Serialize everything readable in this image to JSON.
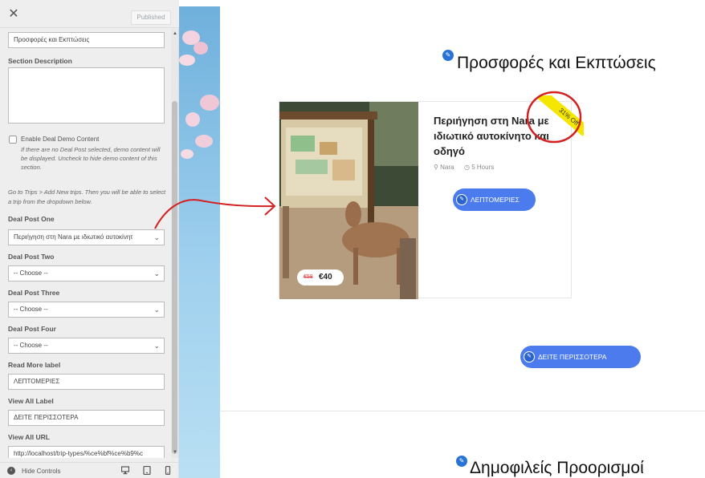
{
  "panel": {
    "published_label": "Published",
    "section_title_value": "Προσφορές και Εκπτώσεις",
    "section_description_label": "Section Description",
    "enable_demo_label": "Enable Deal Demo Content",
    "enable_demo_desc": "If there are no Deal Post selected, demo content will be displayed. Uncheck to hide demo content of this section.",
    "trips_hint": "Go to Trips > Add New trips. Then you will be able to select a trip from the dropdown below.",
    "deal_post_one_label": "Deal Post One",
    "deal_post_one_value": "Περιήγηση στη Nara με ιδιωτικό αυτοκίνητ",
    "deal_post_two_label": "Deal Post Two",
    "deal_post_two_value": "-- Choose --",
    "deal_post_three_label": "Deal Post Three",
    "deal_post_three_value": "-- Choose --",
    "deal_post_four_label": "Deal Post Four",
    "deal_post_four_value": "-- Choose --",
    "read_more_label": "Read More label",
    "read_more_value": "ΛΕΠΤΟΜΕΡΙΕΣ",
    "view_all_label": "View All Label",
    "view_all_value": "ΔΕΙΤΕ ΠΕΡΙΣΣΟΤΕΡΑ",
    "view_all_url_label": "View All URL",
    "view_all_url_value": "http://localhost/trip-types/%ce%bf%ce%b9%c",
    "hide_controls_label": "Hide Controls"
  },
  "preview": {
    "section_title": "Προσφορές και Εκπτώσεις",
    "trip_title": "Περιήγηση στη Nara με ιδιωτικό αυτοκίνητο και οδηγό",
    "location": "Nara",
    "duration": "5 Hours",
    "discount_badge": "31% Off",
    "read_more_button": "ΛΕΠΤΟΜΕΡΙΕΣ",
    "price_old": "€58",
    "price_new": "€40",
    "view_all_button": "ΔΕΙΤΕ ΠΕΡΙΣΣΟΤΕΡΑ",
    "next_section_title": "Δημοφιλείς Προορισμοί"
  },
  "colors": {
    "accent": "#4b7bec",
    "annotation_red": "#d42020",
    "badge_yellow": "#f5e600"
  }
}
